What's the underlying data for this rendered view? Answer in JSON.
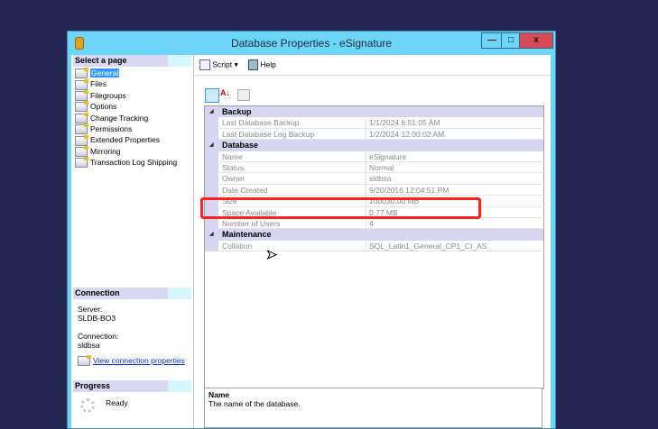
{
  "window": {
    "title": "Database Properties - eSignature",
    "minimize": "—",
    "maximize": "□",
    "close": "x"
  },
  "left": {
    "select_header": "Select a page",
    "pages": [
      "General",
      "Files",
      "Filegroups",
      "Options",
      "Change Tracking",
      "Permissions",
      "Extended Properties",
      "Mirroring",
      "Transaction Log Shipping"
    ],
    "connection_header": "Connection",
    "server_label": "Server:",
    "server": "SLDB-BO3",
    "connection_label": "Connection:",
    "connection": "sldbsa",
    "view_link": "View connection properties",
    "progress_header": "Progress",
    "progress_status": "Ready"
  },
  "toolbar": {
    "script": "Script",
    "help": "Help"
  },
  "grid": {
    "categories": [
      {
        "name": "Backup",
        "props": [
          [
            "Last Database Backup",
            "1/1/2024 6:51:05 AM"
          ],
          [
            "Last Database Log Backup",
            "1/2/2024 12:00:02 AM"
          ]
        ]
      },
      {
        "name": "Database",
        "props": [
          [
            "Name",
            "eSignature"
          ],
          [
            "Status",
            "Normal"
          ],
          [
            "Owner",
            "sldbsa"
          ],
          [
            "Date Created",
            "9/20/2016 12:04:51 PM"
          ],
          [
            "Size",
            "100030.00 MB"
          ],
          [
            "Space Available",
            "0.77 MB"
          ],
          [
            "Number of Users",
            "4"
          ]
        ]
      },
      {
        "name": "Maintenance",
        "props": [
          [
            "Collation",
            "SQL_Latin1_General_CP1_CI_AS"
          ]
        ]
      }
    ]
  },
  "description": {
    "title": "Name",
    "text": "The name of the database."
  },
  "colors": {
    "highlight": "#ff2020",
    "titlebar": "#6dd6f8",
    "desktop": "#262654"
  }
}
